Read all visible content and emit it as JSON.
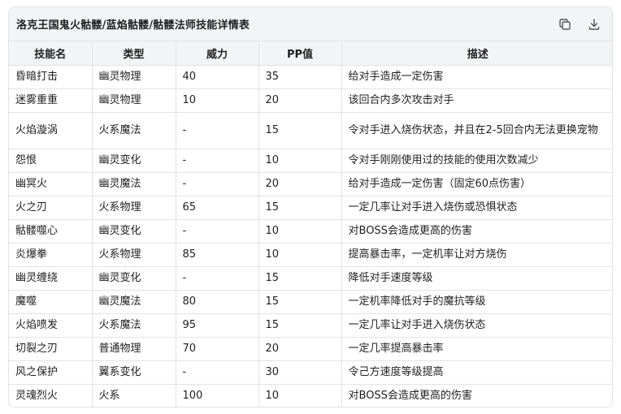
{
  "title": "洛克王国鬼火骷髅/蓝焰骷髅/骷髅法师技能详情表",
  "icons": {
    "copy": "copy-icon",
    "download": "download-icon"
  },
  "columns": [
    "技能名",
    "类型",
    "威力",
    "PP值",
    "描述"
  ],
  "rows": [
    [
      "昏暗打击",
      "幽灵物理",
      "40",
      "35",
      "给对手造成一定伤害"
    ],
    [
      "迷雾重重",
      "幽灵物理",
      "10",
      "20",
      "该回合内多次攻击对手"
    ],
    [
      "火焰漩涡",
      "火系魔法",
      "-",
      "15",
      "令对手进入烧伤状态，并且在2-5回合内无法更换宠物"
    ],
    [
      "怨恨",
      "幽灵变化",
      "-",
      "10",
      "令对手刚刚使用过的技能的使用次数减少"
    ],
    [
      "幽冥火",
      "幽灵魔法",
      "-",
      "20",
      "给对手造成一定伤害（固定60点伤害）"
    ],
    [
      "火之刃",
      "火系物理",
      "65",
      "15",
      "一定几率让对手进入烧伤或恐惧状态"
    ],
    [
      "骷髅噬心",
      "幽灵变化",
      "-",
      "10",
      "对BOSS会造成更高的伤害"
    ],
    [
      "炎爆拳",
      "火系物理",
      "85",
      "10",
      "提高暴击率，一定机率让对方烧伤"
    ],
    [
      "幽灵缠绕",
      "幽灵变化",
      "-",
      "15",
      "降低对手速度等级"
    ],
    [
      "魔噬",
      "幽灵魔法",
      "80",
      "15",
      "一定机率降低对手的魔抗等级"
    ],
    [
      "火焰喷发",
      "火系魔法",
      "95",
      "15",
      "一定几率让对手进入烧伤状态"
    ],
    [
      "切裂之刃",
      "普通物理",
      "70",
      "20",
      "一定几率提高暴击率"
    ],
    [
      "风之保护",
      "翼系变化",
      "-",
      "30",
      "令己方速度等级提高"
    ],
    [
      "灵魂烈火",
      "火系",
      "100",
      "10",
      "对BOSS会造成更高的伤害"
    ]
  ]
}
